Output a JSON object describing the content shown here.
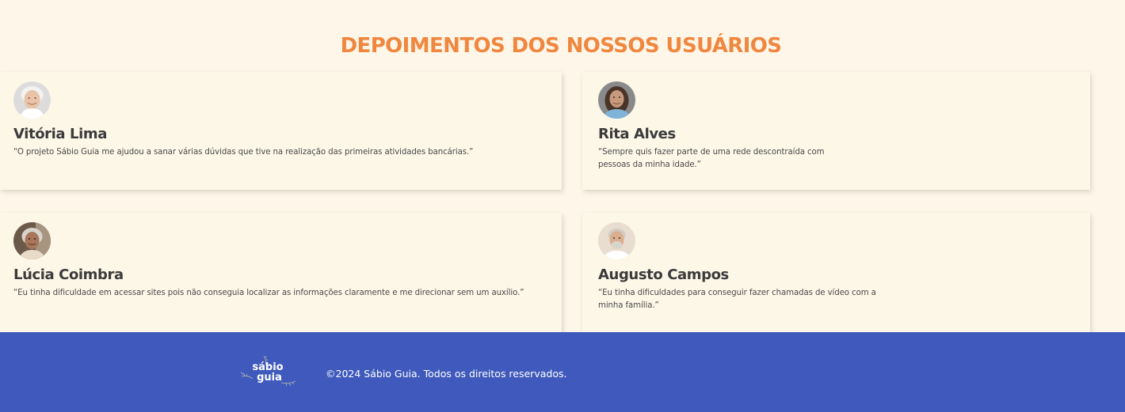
{
  "section": {
    "title": "DEPOIMENTOS DOS NOSSOS USUÁRIOS"
  },
  "testimonials": [
    {
      "name": "Vitória Lima",
      "quote": "“O projeto Sábio Guia me ajudou a sanar várias dúvidas que tive na realização das primeiras atividades bancárias.”",
      "avatar": "avatar-photo-elderly-woman"
    },
    {
      "name": "Rita Alves",
      "quote": "“Sempre quis fazer parte de uma rede descontraída com pessoas da minha idade.”",
      "avatar": "avatar-photo-woman"
    },
    {
      "name": "Lúcia Coimbra",
      "quote": "“Eu tinha dificuldade em acessar sites pois não conseguia localizar as informações claramente e me direcionar sem um auxílio.”",
      "avatar": "avatar-photo-elderly-woman"
    },
    {
      "name": "Augusto Campos",
      "quote": "“Eu tinha dificuldades para conseguir fazer chamadas de vídeo com a minha família.”",
      "avatar": "avatar-photo-elderly-man"
    }
  ],
  "footer": {
    "logo_line1": "sábio",
    "logo_line2": "guia",
    "copyright": "©2024 Sábio Guia. Todos os direitos reservados."
  },
  "colors": {
    "background": "#fef7e9",
    "accent": "#f0873f",
    "footer": "#3f5abc",
    "text": "#3b3b3b"
  }
}
